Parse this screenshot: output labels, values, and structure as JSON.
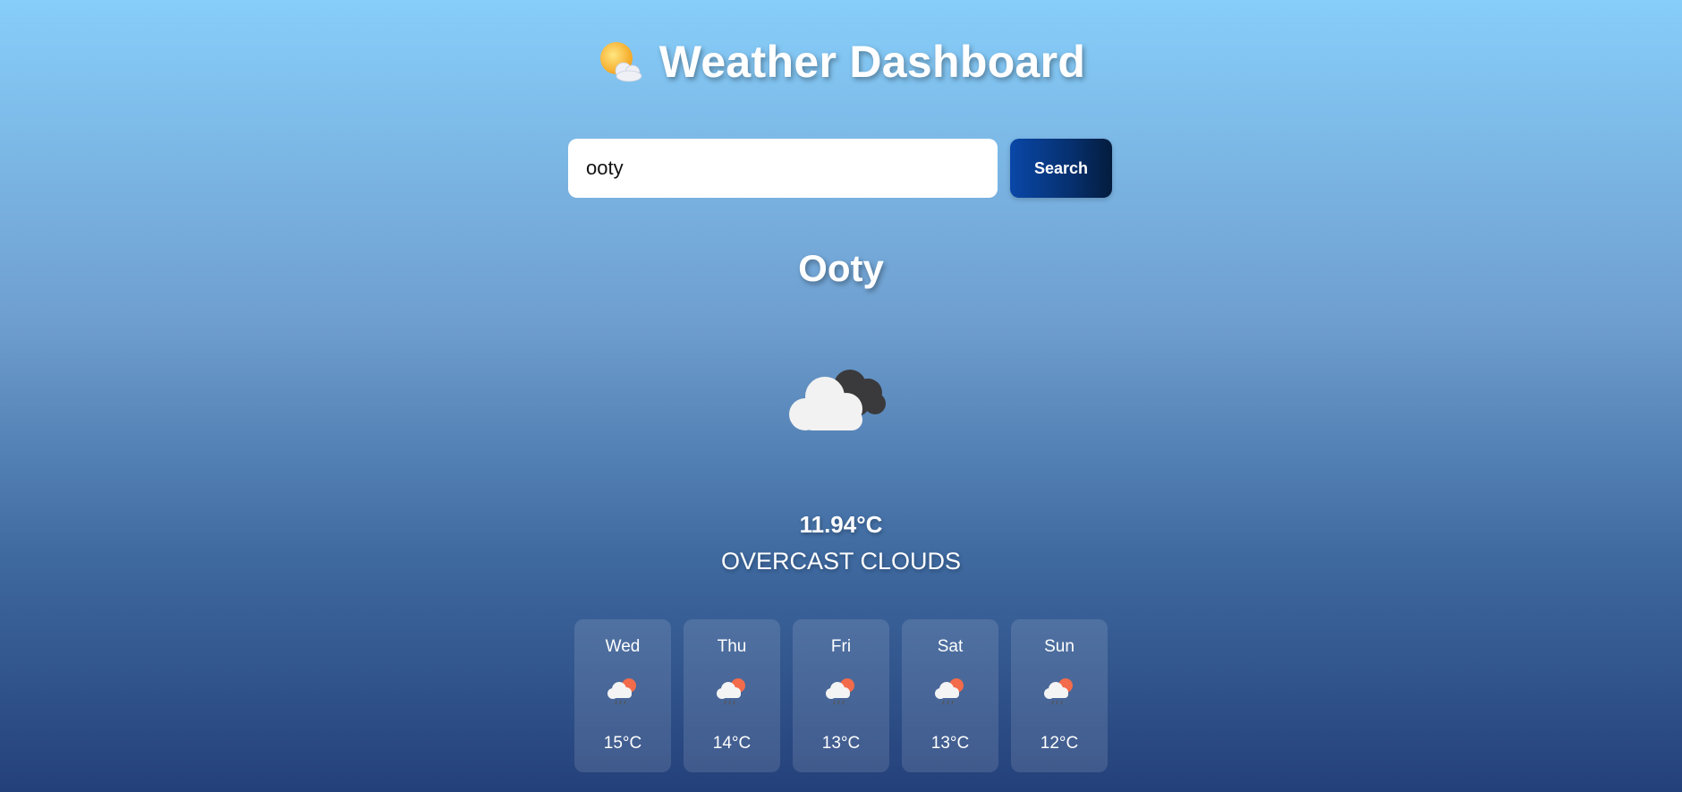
{
  "header": {
    "icon": "sun-behind-cloud-icon",
    "title": "Weather Dashboard"
  },
  "search": {
    "value": "ooty",
    "button_label": "Search"
  },
  "current": {
    "city": "Ooty",
    "icon": "overcast-clouds-icon",
    "temperature": "11.94°C",
    "description": "OVERCAST CLOUDS"
  },
  "forecast": [
    {
      "day": "Wed",
      "icon": "rain-with-sun-icon",
      "temp": "15°C"
    },
    {
      "day": "Thu",
      "icon": "rain-with-sun-icon",
      "temp": "14°C"
    },
    {
      "day": "Fri",
      "icon": "rain-with-sun-icon",
      "temp": "13°C"
    },
    {
      "day": "Sat",
      "icon": "rain-with-sun-icon",
      "temp": "13°C"
    },
    {
      "day": "Sun",
      "icon": "rain-with-sun-icon",
      "temp": "12°C"
    }
  ],
  "colors": {
    "button": "#06306e",
    "background_top": "#87cefa",
    "background_bottom": "#24407a"
  }
}
